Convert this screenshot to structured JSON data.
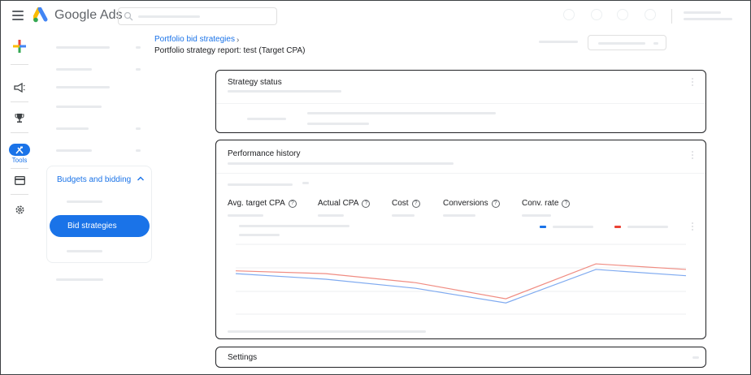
{
  "app": {
    "logo_text": "Google Ads"
  },
  "rail": {
    "tools_label": "Tools"
  },
  "nav": {
    "budgets_section": "Budgets and bidding",
    "active_item": "Bid strategies"
  },
  "breadcrumb": {
    "parent": "Portfolio bid strategies"
  },
  "page": {
    "title": "Portfolio strategy report: test (Target CPA)"
  },
  "cards": {
    "strategy_status": "Strategy status",
    "performance_history": "Performance history",
    "settings": "Settings"
  },
  "metrics": [
    {
      "label": "Avg. target CPA"
    },
    {
      "label": "Actual CPA"
    },
    {
      "label": "Cost"
    },
    {
      "label": "Conversions"
    },
    {
      "label": "Conv. rate"
    }
  ],
  "colors": {
    "accent": "#1a73e8",
    "series_blue": "#7faaf0",
    "series_red": "#f08c82"
  },
  "chart_data": {
    "type": "line",
    "title": "",
    "xlabel": "",
    "ylabel": "",
    "x": [
      0,
      1,
      2,
      3,
      4,
      5
    ],
    "series": [
      {
        "color": "#f08c82",
        "values": [
          0.62,
          0.58,
          0.45,
          0.22,
          0.72,
          0.64
        ]
      },
      {
        "color": "#7faaf0",
        "values": [
          0.58,
          0.5,
          0.37,
          0.16,
          0.64,
          0.55
        ]
      }
    ],
    "ylim": [
      0,
      1
    ],
    "grid": true
  }
}
